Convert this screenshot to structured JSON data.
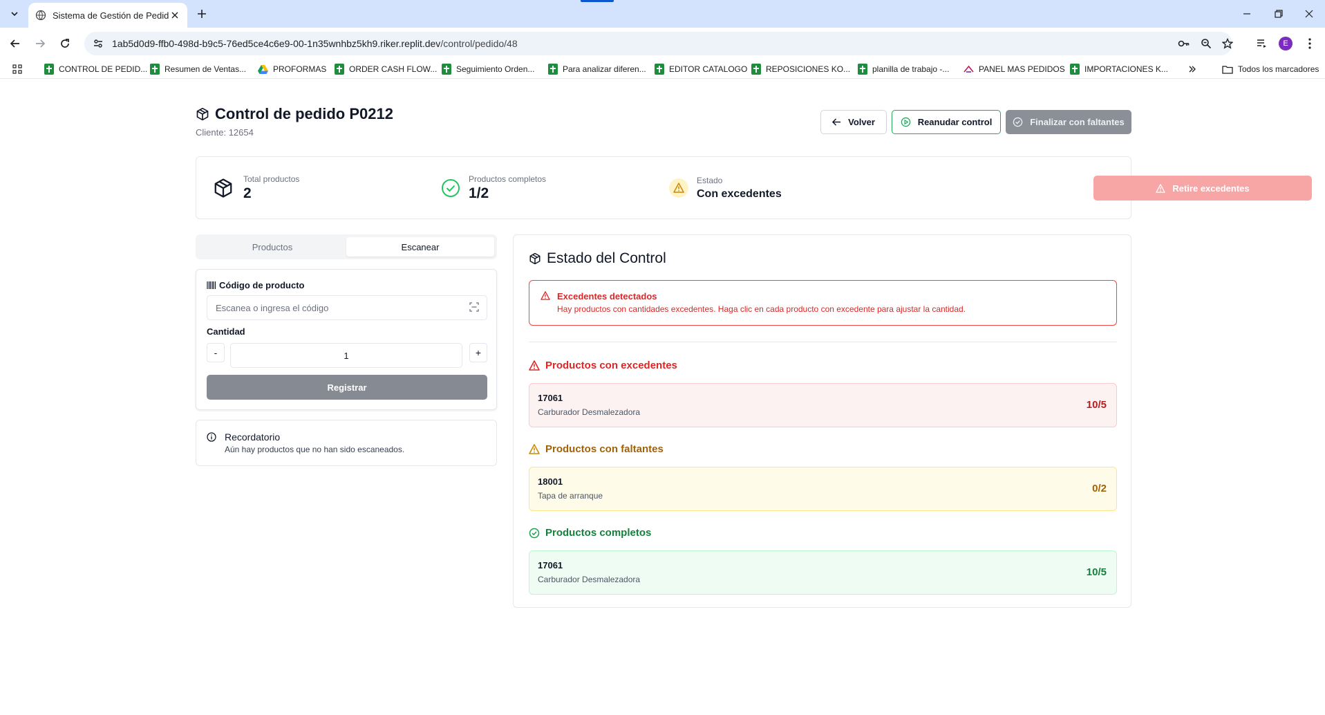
{
  "browser": {
    "tab_title": "Sistema de Gestión de Pedidos",
    "url_host": "1ab5d0d9-ffb0-498d-b9c5-76ed5ce4c6e9-00-1n35wnhbz5kh9.riker.replit.dev",
    "url_path": "/control/pedido/48",
    "avatar_letter": "E",
    "bookmarks": [
      {
        "label": "CONTROL DE PEDID...",
        "icon": "sheets-icon"
      },
      {
        "label": "Resumen de Ventas...",
        "icon": "sheets-icon"
      },
      {
        "label": "PROFORMAS",
        "icon": "drive-icon"
      },
      {
        "label": "ORDER CASH FLOW...",
        "icon": "sheets-icon"
      },
      {
        "label": "Seguimiento Orden...",
        "icon": "sheets-icon"
      },
      {
        "label": "Para analizar diferen...",
        "icon": "sheets-icon"
      },
      {
        "label": "EDITOR CATALOGO",
        "icon": "sheets-icon"
      },
      {
        "label": "REPOSICIONES KO...",
        "icon": "sheets-icon"
      },
      {
        "label": "planilla de trabajo -...",
        "icon": "sheets-icon"
      },
      {
        "label": "PANEL MAS PEDIDOS",
        "icon": "app-icon"
      },
      {
        "label": "IMPORTACIONES K...",
        "icon": "sheets-icon"
      }
    ],
    "all_bookmarks": "Todos los marcadores"
  },
  "header": {
    "title": "Control de pedido P0212",
    "client": "Cliente: 12654",
    "back_label": "Volver",
    "resume_label": "Reanudar control",
    "finish_label": "Finalizar con faltantes"
  },
  "stats": {
    "total_label": "Total productos",
    "total_value": "2",
    "complete_label": "Productos completos",
    "complete_value": "1/2",
    "state_label": "Estado",
    "state_value": "Con excedentes",
    "retire_label": "Retire excedentes"
  },
  "tabs": {
    "products": "Productos",
    "scan": "Escanear"
  },
  "scan": {
    "code_label": "Código de producto",
    "code_placeholder": "Escanea o ingresa el código",
    "qty_label": "Cantidad",
    "qty_value": "1",
    "minus": "-",
    "plus": "+",
    "submit": "Registrar"
  },
  "reminder": {
    "title": "Recordatorio",
    "text": "Aún hay productos que no han sido escaneados."
  },
  "control": {
    "title": "Estado del Control",
    "alert_title": "Excedentes detectados",
    "alert_text": "Hay productos con cantidades excedentes. Haga clic en cada producto con excedente para ajustar la cantidad.",
    "excess_title": "Productos con excedentes",
    "excess": [
      {
        "code": "17061",
        "name": "Carburador Desmalezadora",
        "count": "10/5"
      }
    ],
    "missing_title": "Productos con faltantes",
    "missing": [
      {
        "code": "18001",
        "name": "Tapa de arranque",
        "count": "0/2"
      }
    ],
    "complete_title": "Productos completos",
    "complete": [
      {
        "code": "17061",
        "name": "Carburador Desmalezadora",
        "count": "10/5"
      }
    ]
  },
  "colors": {
    "danger": "#dc2626",
    "warning": "#a16207",
    "success": "#15803d",
    "excess_bg": "#fdf2f2",
    "missing_bg": "#fefbe8",
    "complete_bg": "#effcf3"
  }
}
